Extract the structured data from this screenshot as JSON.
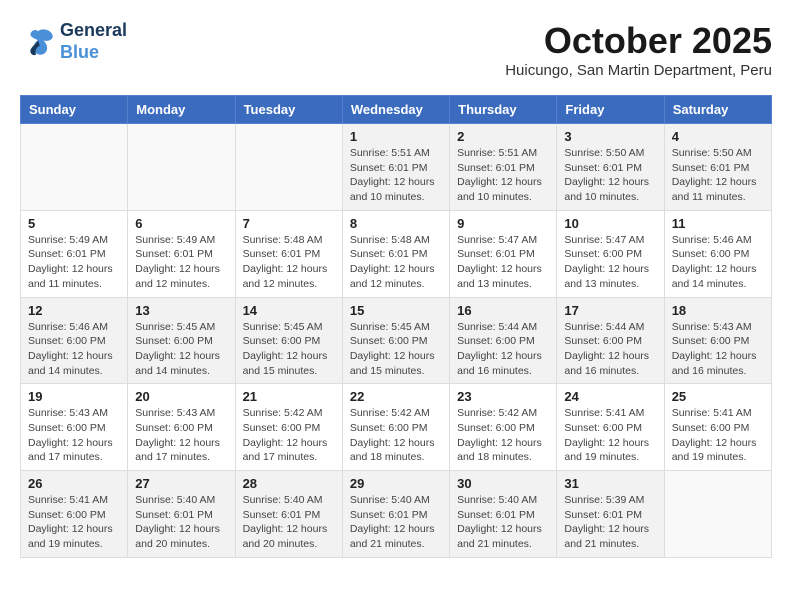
{
  "header": {
    "logo_line1": "General",
    "logo_line2": "Blue",
    "month": "October 2025",
    "location": "Huicungo, San Martin Department, Peru"
  },
  "days_of_week": [
    "Sunday",
    "Monday",
    "Tuesday",
    "Wednesday",
    "Thursday",
    "Friday",
    "Saturday"
  ],
  "weeks": [
    [
      {
        "day": "",
        "detail": ""
      },
      {
        "day": "",
        "detail": ""
      },
      {
        "day": "",
        "detail": ""
      },
      {
        "day": "1",
        "detail": "Sunrise: 5:51 AM\nSunset: 6:01 PM\nDaylight: 12 hours and 10 minutes."
      },
      {
        "day": "2",
        "detail": "Sunrise: 5:51 AM\nSunset: 6:01 PM\nDaylight: 12 hours and 10 minutes."
      },
      {
        "day": "3",
        "detail": "Sunrise: 5:50 AM\nSunset: 6:01 PM\nDaylight: 12 hours and 10 minutes."
      },
      {
        "day": "4",
        "detail": "Sunrise: 5:50 AM\nSunset: 6:01 PM\nDaylight: 12 hours and 11 minutes."
      }
    ],
    [
      {
        "day": "5",
        "detail": "Sunrise: 5:49 AM\nSunset: 6:01 PM\nDaylight: 12 hours and 11 minutes."
      },
      {
        "day": "6",
        "detail": "Sunrise: 5:49 AM\nSunset: 6:01 PM\nDaylight: 12 hours and 12 minutes."
      },
      {
        "day": "7",
        "detail": "Sunrise: 5:48 AM\nSunset: 6:01 PM\nDaylight: 12 hours and 12 minutes."
      },
      {
        "day": "8",
        "detail": "Sunrise: 5:48 AM\nSunset: 6:01 PM\nDaylight: 12 hours and 12 minutes."
      },
      {
        "day": "9",
        "detail": "Sunrise: 5:47 AM\nSunset: 6:01 PM\nDaylight: 12 hours and 13 minutes."
      },
      {
        "day": "10",
        "detail": "Sunrise: 5:47 AM\nSunset: 6:00 PM\nDaylight: 12 hours and 13 minutes."
      },
      {
        "day": "11",
        "detail": "Sunrise: 5:46 AM\nSunset: 6:00 PM\nDaylight: 12 hours and 14 minutes."
      }
    ],
    [
      {
        "day": "12",
        "detail": "Sunrise: 5:46 AM\nSunset: 6:00 PM\nDaylight: 12 hours and 14 minutes."
      },
      {
        "day": "13",
        "detail": "Sunrise: 5:45 AM\nSunset: 6:00 PM\nDaylight: 12 hours and 14 minutes."
      },
      {
        "day": "14",
        "detail": "Sunrise: 5:45 AM\nSunset: 6:00 PM\nDaylight: 12 hours and 15 minutes."
      },
      {
        "day": "15",
        "detail": "Sunrise: 5:45 AM\nSunset: 6:00 PM\nDaylight: 12 hours and 15 minutes."
      },
      {
        "day": "16",
        "detail": "Sunrise: 5:44 AM\nSunset: 6:00 PM\nDaylight: 12 hours and 16 minutes."
      },
      {
        "day": "17",
        "detail": "Sunrise: 5:44 AM\nSunset: 6:00 PM\nDaylight: 12 hours and 16 minutes."
      },
      {
        "day": "18",
        "detail": "Sunrise: 5:43 AM\nSunset: 6:00 PM\nDaylight: 12 hours and 16 minutes."
      }
    ],
    [
      {
        "day": "19",
        "detail": "Sunrise: 5:43 AM\nSunset: 6:00 PM\nDaylight: 12 hours and 17 minutes."
      },
      {
        "day": "20",
        "detail": "Sunrise: 5:43 AM\nSunset: 6:00 PM\nDaylight: 12 hours and 17 minutes."
      },
      {
        "day": "21",
        "detail": "Sunrise: 5:42 AM\nSunset: 6:00 PM\nDaylight: 12 hours and 17 minutes."
      },
      {
        "day": "22",
        "detail": "Sunrise: 5:42 AM\nSunset: 6:00 PM\nDaylight: 12 hours and 18 minutes."
      },
      {
        "day": "23",
        "detail": "Sunrise: 5:42 AM\nSunset: 6:00 PM\nDaylight: 12 hours and 18 minutes."
      },
      {
        "day": "24",
        "detail": "Sunrise: 5:41 AM\nSunset: 6:00 PM\nDaylight: 12 hours and 19 minutes."
      },
      {
        "day": "25",
        "detail": "Sunrise: 5:41 AM\nSunset: 6:00 PM\nDaylight: 12 hours and 19 minutes."
      }
    ],
    [
      {
        "day": "26",
        "detail": "Sunrise: 5:41 AM\nSunset: 6:00 PM\nDaylight: 12 hours and 19 minutes."
      },
      {
        "day": "27",
        "detail": "Sunrise: 5:40 AM\nSunset: 6:01 PM\nDaylight: 12 hours and 20 minutes."
      },
      {
        "day": "28",
        "detail": "Sunrise: 5:40 AM\nSunset: 6:01 PM\nDaylight: 12 hours and 20 minutes."
      },
      {
        "day": "29",
        "detail": "Sunrise: 5:40 AM\nSunset: 6:01 PM\nDaylight: 12 hours and 21 minutes."
      },
      {
        "day": "30",
        "detail": "Sunrise: 5:40 AM\nSunset: 6:01 PM\nDaylight: 12 hours and 21 minutes."
      },
      {
        "day": "31",
        "detail": "Sunrise: 5:39 AM\nSunset: 6:01 PM\nDaylight: 12 hours and 21 minutes."
      },
      {
        "day": "",
        "detail": ""
      }
    ]
  ]
}
